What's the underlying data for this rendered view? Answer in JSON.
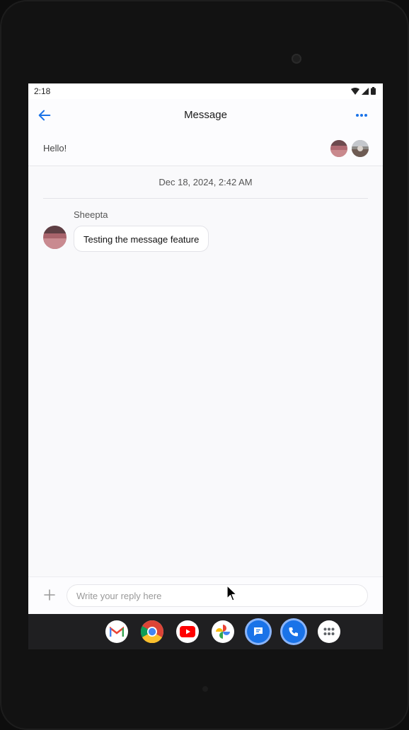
{
  "status_bar": {
    "time": "2:18"
  },
  "app_bar": {
    "title": "Message"
  },
  "conversation": {
    "subject": "Hello!",
    "date": "Dec 18, 2024, 2:42 AM",
    "messages": [
      {
        "sender": "Sheepta",
        "text": "Testing the message feature"
      }
    ]
  },
  "composer": {
    "placeholder": "Write your reply here"
  },
  "taskbar": {
    "apps": [
      "gmail-icon",
      "chrome-icon",
      "youtube-icon",
      "photos-icon",
      "messages-icon",
      "phone-icon",
      "app-drawer-icon"
    ]
  },
  "colors": {
    "accent": "#1a73e8",
    "background": "#f9f9fb",
    "taskbar": "#1f1f21"
  }
}
